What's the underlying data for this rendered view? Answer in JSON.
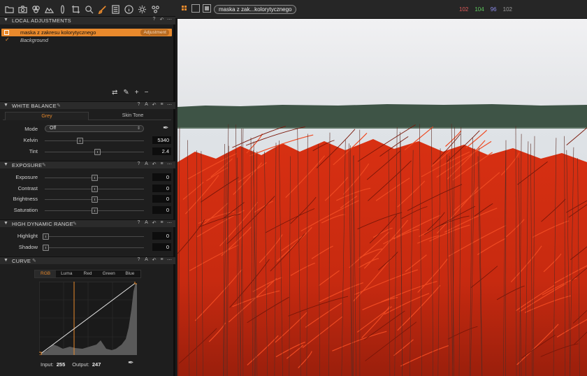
{
  "toolbar": {
    "tools": [
      "folder-icon",
      "camera-icon",
      "color-circles-icon",
      "levels-icon",
      "lens-icon",
      "crop-icon",
      "search-icon",
      "brush-icon",
      "metadata-icon",
      "info-icon",
      "gear-icon",
      "adjustments-icon"
    ],
    "active_tool": "brush-icon",
    "variant_name": "maska z zak...kolorytycznego",
    "rgb": {
      "r": "102",
      "g": "104",
      "b": "96",
      "l": "102"
    }
  },
  "colors": {
    "accent": "#e8892c",
    "red_readout": "#e05a5a",
    "green_readout": "#5ec95e",
    "blue_readout": "#8a8ae8",
    "mask_red": "#d22a10"
  },
  "local_adjustments": {
    "title": "LOCAL ADJUSTMENTS",
    "layers": [
      {
        "name": "maska z zakresu kolorytycznego",
        "badge": "Adjustment",
        "selected": true
      },
      {
        "name": "Background",
        "selected": false
      }
    ]
  },
  "white_balance": {
    "title": "WHITE BALANCE",
    "tabs": [
      "Grey",
      "Skin Tone"
    ],
    "mode_label": "Mode",
    "mode_value": "Off",
    "sliders": [
      {
        "label": "Kelvin",
        "value": "5340",
        "pos": 0.35
      },
      {
        "label": "Tint",
        "value": "2.4",
        "pos": 0.53
      }
    ]
  },
  "exposure": {
    "title": "EXPOSURE",
    "sliders": [
      {
        "label": "Exposure",
        "value": "0",
        "pos": 0.5
      },
      {
        "label": "Contrast",
        "value": "0",
        "pos": 0.5
      },
      {
        "label": "Brightness",
        "value": "0",
        "pos": 0.5
      },
      {
        "label": "Saturation",
        "value": "0",
        "pos": 0.5
      }
    ]
  },
  "hdr": {
    "title": "HIGH DYNAMIC RANGE",
    "sliders": [
      {
        "label": "Highlight",
        "value": "0",
        "pos": 0.01
      },
      {
        "label": "Shadow",
        "value": "0",
        "pos": 0.01
      }
    ]
  },
  "curve": {
    "title": "CURVE",
    "tabs": [
      "RGB",
      "Luma",
      "Red",
      "Green",
      "Blue"
    ],
    "input_label": "Input:",
    "input_value": "255",
    "output_label": "Output:",
    "output_value": "247"
  }
}
